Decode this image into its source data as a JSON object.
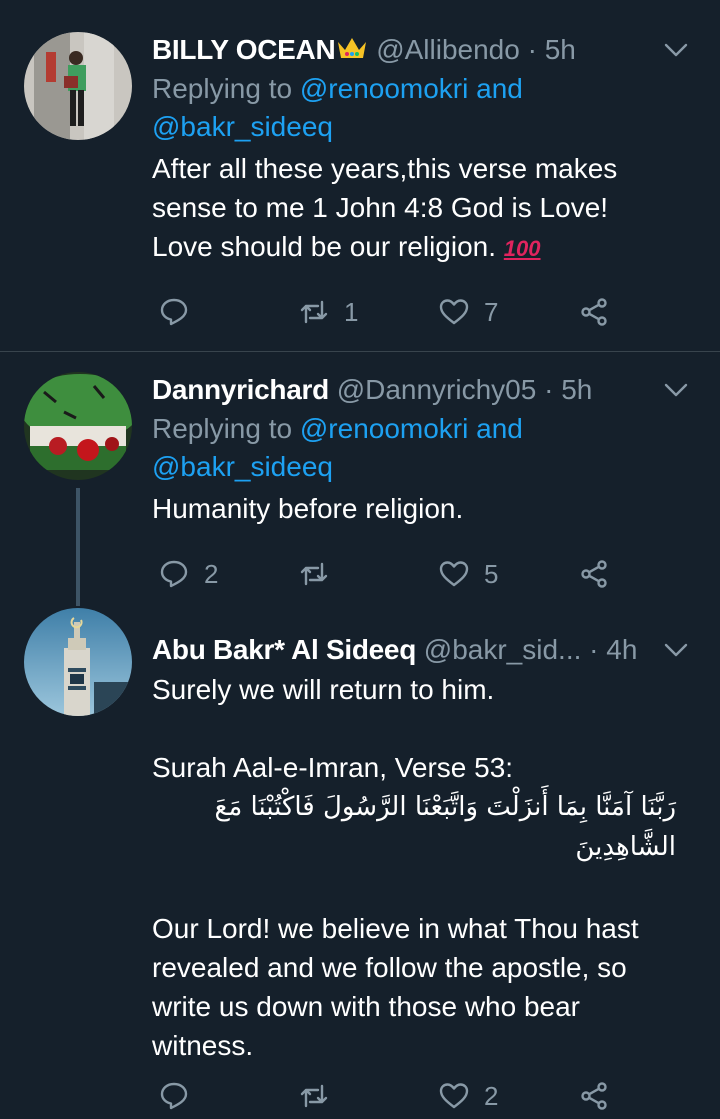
{
  "tweets": [
    {
      "name": "BILLY OCEAN",
      "has_crown": true,
      "handle": "@Allibendo",
      "dot": "·",
      "time": "5h",
      "replying_prefix": "Replying to",
      "replying_link1": "@renoomokri",
      "replying_and": "and",
      "replying_link2": "@bakr_sideeq",
      "body_lines": [
        "After all these years,this verse makes",
        "sense to me 1 John 4:8 God is Love!",
        "Love should be our religion."
      ],
      "emoji": "100",
      "reply_count": "",
      "retweet_count": "1",
      "like_count": "7"
    },
    {
      "name": "Dannyrichard",
      "handle": "@Dannyrichy05",
      "dot": "·",
      "time": "5h",
      "replying_prefix": "Replying to",
      "replying_link1": "@renoomokri",
      "replying_and": "and",
      "replying_link2": "@bakr_sideeq",
      "body_lines": [
        "Humanity before religion."
      ],
      "reply_count": "2",
      "retweet_count": "",
      "like_count": "5"
    },
    {
      "name": "Abu Bakr* Al Sideeq",
      "handle": "@bakr_sid...",
      "dot": "·",
      "time": "4h",
      "body_lines": [
        "Surely we will return to him."
      ],
      "surah": "Surah Aal-e-Imran, Verse 53:",
      "arabic_lines": [
        "رَبَّنَا آمَنَّا بِمَا أَنزَلْتَ وَاتَّبَعْنَا الرَّسُولَ فَاكْتُبْنَا مَعَ",
        "الشَّاهِدِينَ"
      ],
      "translation_lines": [
        "Our Lord! we believe in what Thou hast",
        "revealed and we follow the apostle, so",
        "write us down with those who bear",
        "witness."
      ],
      "reply_count": "",
      "retweet_count": "",
      "like_count": "2"
    }
  ],
  "icons": {
    "reply": "reply-icon",
    "retweet": "retweet-icon",
    "like": "heart-icon",
    "share": "share-icon",
    "caret": "chevron-down-icon"
  },
  "colors": {
    "background": "#15202b",
    "secondary_text": "#8899a6",
    "link": "#1da1f2",
    "divider": "#38444d"
  }
}
